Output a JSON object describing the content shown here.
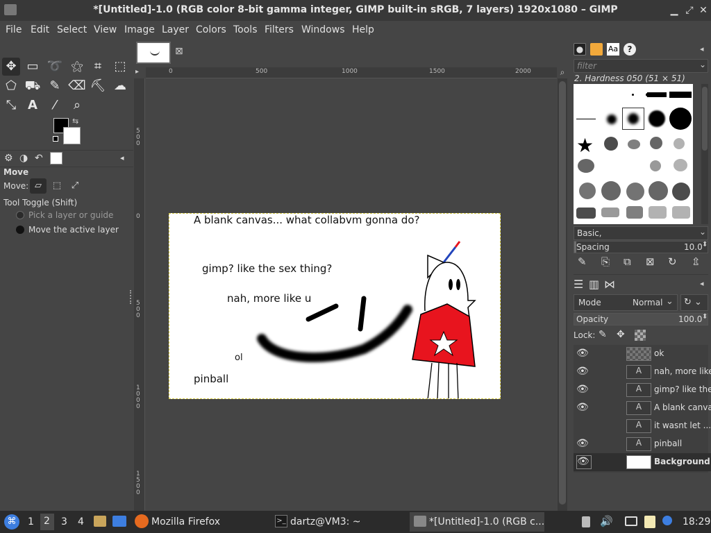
{
  "window": {
    "title": "*[Untitled]-1.0 (RGB color 8-bit gamma integer, GIMP built-in sRGB, 7 layers) 1920x1080 – GIMP"
  },
  "menu": [
    "File",
    "Edit",
    "Select",
    "View",
    "Image",
    "Layer",
    "Colors",
    "Tools",
    "Filters",
    "Windows",
    "Help"
  ],
  "ruler": {
    "h_ticks": [
      "0",
      "500",
      "1000",
      "1500",
      "2000"
    ],
    "v_ticks": [
      "500",
      "0",
      "500",
      "1000",
      "1500"
    ]
  },
  "tool_options": {
    "tool_name": "Move",
    "move_label": "Move:",
    "toggle_label": "Tool Toggle  (Shift)",
    "option_pick": "Pick a layer or guide",
    "option_move": "Move the active layer"
  },
  "canvas_text": {
    "line1": "A blank canvas... what collabvm gonna do?",
    "line2": "gimp? like the sex thing?",
    "line3": "nah, more like u",
    "line4": "pinball",
    "partial": "ol"
  },
  "brushes": {
    "filter_placeholder": "filter",
    "selected_name": "2. Hardness 050 (51 × 51)",
    "preset": "Basic,",
    "spacing_label": "Spacing",
    "spacing_value": "10.0"
  },
  "layers_panel": {
    "mode_label": "Mode",
    "mode_value": "Normal",
    "opacity_label": "Opacity",
    "opacity_value": "100.0",
    "lock_label": "Lock:",
    "layers": [
      {
        "name": "ok",
        "visible": true,
        "type": "transparent"
      },
      {
        "name": "nah, more like",
        "visible": true,
        "type": "text"
      },
      {
        "name": "gimp? like the",
        "visible": true,
        "type": "text"
      },
      {
        "name": "A blank canva",
        "visible": true,
        "type": "text"
      },
      {
        "name": "it wasnt let ...",
        "visible": false,
        "type": "text"
      },
      {
        "name": "pinball",
        "visible": true,
        "type": "text"
      },
      {
        "name": "Background",
        "visible": true,
        "type": "image"
      }
    ]
  },
  "taskbar": {
    "workspaces": [
      "1",
      "2",
      "3",
      "4"
    ],
    "firefox": "Mozilla Firefox",
    "terminal": "dartz@VM3: ~",
    "gimp": "*[Untitled]-1.0 (RGB c...",
    "clock": "18:29"
  },
  "colors": {
    "fg": "#000000",
    "bg": "#ffffff",
    "character_red": "#e8141e",
    "ribbon_blue": "#2244bb"
  }
}
